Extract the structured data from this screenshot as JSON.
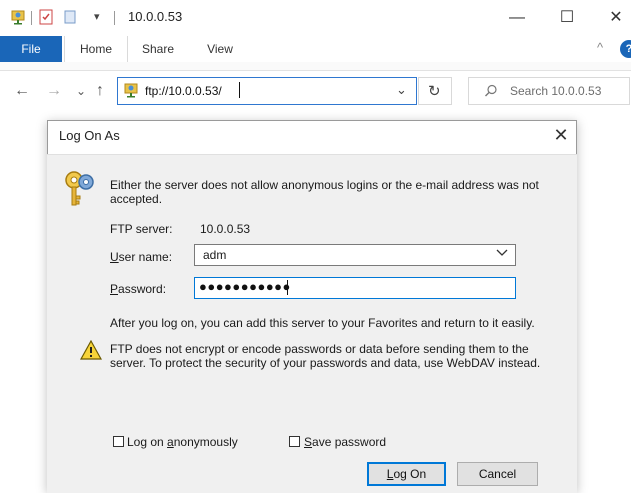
{
  "window": {
    "title": "10.0.0.53",
    "controls": {
      "minimize": "—",
      "maximize": "☐",
      "close": "✕"
    }
  },
  "ribbon": {
    "tabs": [
      "File",
      "Home",
      "Share",
      "View"
    ],
    "help": "?",
    "collapse": "^"
  },
  "address_bar": {
    "path": "ftp://10.0.0.53/",
    "dropdown_glyph": "⌄",
    "refresh_glyph": "↻",
    "search_placeholder": "Search 10.0.0.53"
  },
  "nav": {
    "back": "←",
    "forward": "→",
    "recent": "⌄",
    "up": "↑"
  },
  "dialog": {
    "title": "Log On As",
    "close": "✕",
    "message_line1": "Either the server does not allow anonymous logins or the e-mail address was not",
    "message_line2": "accepted.",
    "ftp_server_label": "FTP server:",
    "ftp_server_value": "10.0.0.53",
    "user_name_label_u": "U",
    "user_name_label_rest": "ser name:",
    "user_name_value": "adm",
    "password_label_u": "P",
    "password_label_rest": "assword:",
    "password_value": "●●●●●●●●●●●",
    "after_logon": "After you log on, you can add this server to your Favorites and return to it easily.",
    "warning_line1": "FTP does not encrypt or encode passwords or data before sending them to the",
    "warning_line2": "server.  To protect the security of your passwords and data, use WebDAV instead.",
    "anon_label_pre": "Log on ",
    "anon_label_u": "a",
    "anon_label_rest": "nonymously",
    "anon_checked": false,
    "save_label_u": "S",
    "save_label_rest": "ave password",
    "save_checked": false,
    "logon_button_u": "L",
    "logon_button_rest": "og On",
    "cancel_button": "Cancel"
  },
  "colors": {
    "accent": "#1a66b8",
    "focus": "#0078d7",
    "dialog_bg": "#f0f0f0"
  }
}
